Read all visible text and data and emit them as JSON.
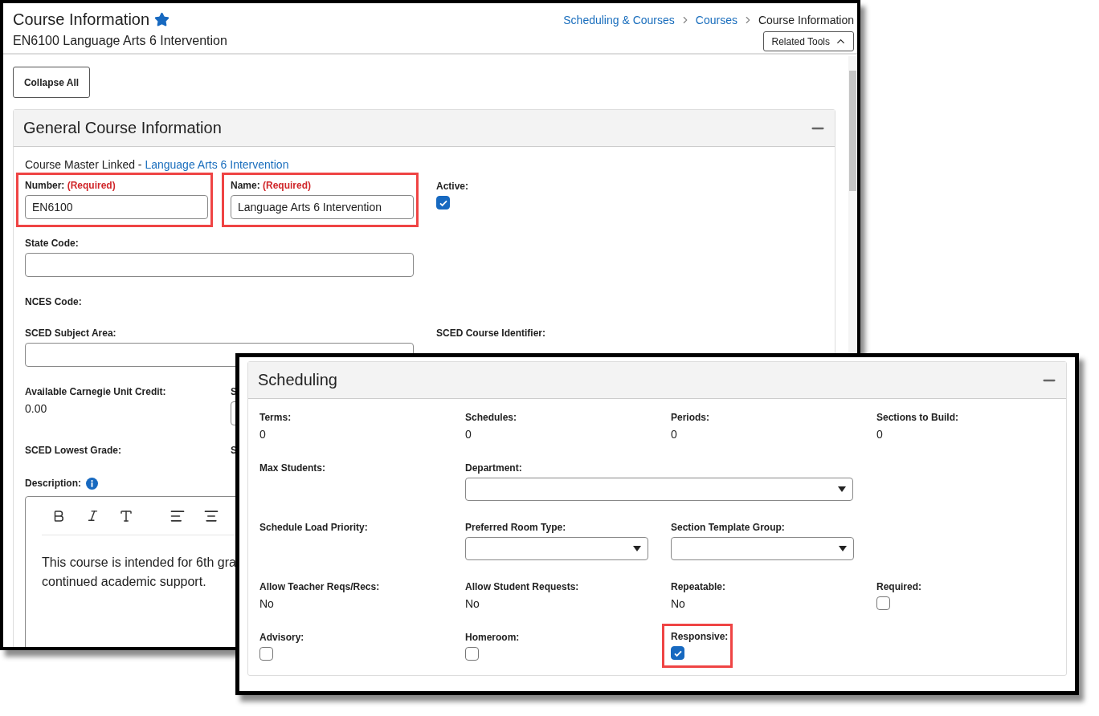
{
  "course_window": {
    "title": "Course Information",
    "favorite": true,
    "subtitle": "EN6100 Language Arts 6 Intervention",
    "breadcrumbs": [
      {
        "label": "Scheduling & Courses",
        "link": true
      },
      {
        "label": "Courses",
        "link": true
      },
      {
        "label": "Course Information",
        "link": false
      }
    ],
    "related_tools": {
      "label": "Related Tools",
      "expanded": true
    },
    "collapse_all": "Collapse All",
    "section": {
      "title": "General Course Information",
      "expanded": true,
      "master_prefix": "Course Master Linked - ",
      "master_link": "Language Arts 6 Intervention",
      "rows": [
        [
          {
            "kind": "input",
            "label": "Number:",
            "required": "(Required)",
            "value": "EN6100",
            "highlighted": true
          },
          {
            "kind": "input",
            "label": "Name:",
            "required": "(Required)",
            "value": "Language Arts 6 Intervention",
            "highlighted": true
          },
          {
            "kind": "checkbox",
            "label": "Active:",
            "checked": true
          }
        ],
        [
          {
            "kind": "wide-input",
            "label": "State Code:"
          }
        ],
        [
          {
            "kind": "label",
            "label": "NCES Code:"
          }
        ],
        [
          {
            "kind": "wide-input",
            "label": "SCED Subject Area:"
          },
          "",
          {
            "kind": "label",
            "label": "SCED Course Identifier:"
          }
        ],
        [
          {
            "kind": "value",
            "label": "Available Carnegie Unit Credit:",
            "value": "0.00"
          },
          {
            "kind": "input",
            "label": "S"
          }
        ],
        [
          {
            "kind": "label",
            "label": "SCED Lowest Grade:"
          },
          {
            "kind": "label",
            "label": "S"
          }
        ]
      ],
      "description": {
        "label": "Description:",
        "lines": [
          "This course is intended for 6th gra",
          "continued academic support."
        ]
      }
    }
  },
  "scheduling_window": {
    "section": {
      "title": "Scheduling",
      "expanded": true,
      "rows": [
        [
          {
            "kind": "value",
            "label": "Terms:",
            "value": "0"
          },
          {
            "kind": "value",
            "label": "Schedules:",
            "value": "0"
          },
          {
            "kind": "value",
            "label": "Periods:",
            "value": "0"
          },
          {
            "kind": "value",
            "label": "Sections to Build:",
            "value": "0"
          }
        ],
        [
          {
            "kind": "label",
            "label": "Max Students:"
          },
          {
            "kind": "wide-select",
            "label": "Department:"
          }
        ],
        [
          {
            "kind": "label",
            "label": "Schedule Load Priority:"
          },
          {
            "kind": "select",
            "label": "Preferred Room Type:"
          },
          {
            "kind": "select",
            "label": "Section Template Group:"
          }
        ],
        [
          {
            "kind": "value",
            "label": "Allow Teacher Reqs/Recs:",
            "value": "No"
          },
          {
            "kind": "value",
            "label": "Allow Student Requests:",
            "value": "No"
          },
          {
            "kind": "value",
            "label": "Repeatable:",
            "value": "No"
          },
          {
            "kind": "checkbox",
            "label": "Required:",
            "checked": false
          }
        ],
        [
          {
            "kind": "checkbox",
            "label": "Advisory:",
            "checked": false
          },
          {
            "kind": "checkbox",
            "label": "Homeroom:",
            "checked": false
          },
          {
            "kind": "checkbox",
            "label": "Responsive:",
            "checked": true,
            "highlighted": true
          }
        ]
      ]
    }
  }
}
